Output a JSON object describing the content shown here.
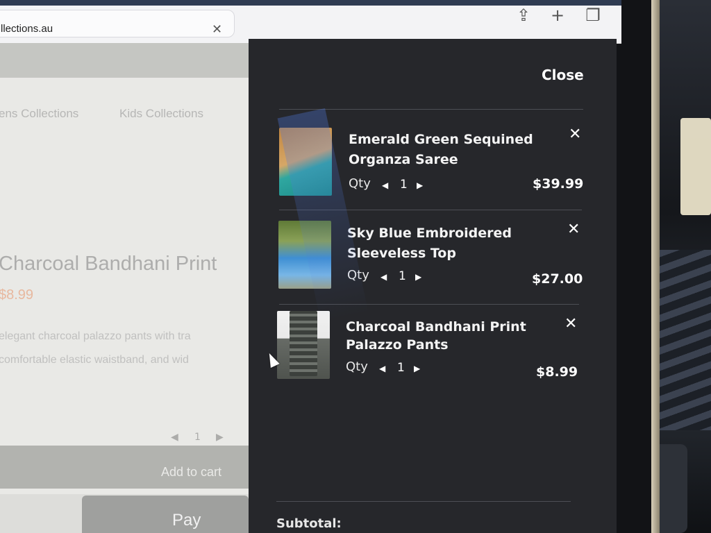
{
  "browser": {
    "url": "llections.au",
    "clear_glyph": "✕",
    "share_glyph": "⇪",
    "newtab_glyph": "+",
    "tabs_glyph": "❐"
  },
  "page": {
    "nav": [
      "ens Collections",
      "Kids Collections"
    ],
    "product_title": "Charcoal Bandhani Print",
    "product_price": "$8.99",
    "desc_lines": [
      "elegant charcoal palazzo pants with tra",
      "comfortable elastic waistband, and wid"
    ],
    "qty_prev": "◀",
    "qty_value": "1",
    "qty_next": "▶",
    "add_to_cart": "Add to cart",
    "apple_pay": " Pay"
  },
  "cart": {
    "close_label": "Close",
    "qty_label": "Qty",
    "dec_glyph": "◀",
    "inc_glyph": "▶",
    "remove_glyph": "✕",
    "items": [
      {
        "name_line1": "Emerald Green Sequined",
        "name_line2": "Organza Saree",
        "qty": "1",
        "price": "$39.99"
      },
      {
        "name_line1": "Sky Blue Embroidered",
        "name_line2": "Sleeveless Top",
        "qty": "1",
        "price": "$27.00"
      },
      {
        "name_line1": "Charcoal Bandhani Print",
        "name_line2": "Palazzo Pants",
        "qty": "1",
        "price": "$8.99"
      }
    ],
    "subtotal_label": "Subtotal:"
  },
  "colors": {
    "drawer_bg": "#26272b",
    "price_accent": "#e3a98a"
  }
}
